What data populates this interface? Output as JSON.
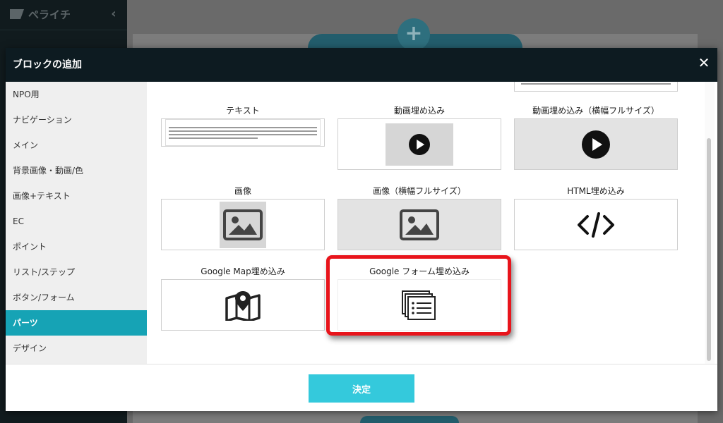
{
  "app": {
    "logo_text": "ペライチ",
    "collapse_glyph": "‹",
    "add_glyph": "+"
  },
  "modal": {
    "title": "ブロックの追加",
    "close_glyph": "✕",
    "confirm_label": "決定",
    "categories": [
      {
        "label": "NPO用",
        "active": false
      },
      {
        "label": "ナビゲーション",
        "active": false
      },
      {
        "label": "メイン",
        "active": false
      },
      {
        "label": "背景画像・動画/色",
        "active": false
      },
      {
        "label": "画像+テキスト",
        "active": false
      },
      {
        "label": "EC",
        "active": false
      },
      {
        "label": "ポイント",
        "active": false
      },
      {
        "label": "リスト/ステップ",
        "active": false
      },
      {
        "label": "ボタン/フォーム",
        "active": false
      },
      {
        "label": "パーツ",
        "active": true
      },
      {
        "label": "デザイン",
        "active": false
      }
    ],
    "tiles": [
      {
        "label": "テキスト",
        "icon": "text-lines-icon"
      },
      {
        "label": "動画埋め込み",
        "icon": "play-icon"
      },
      {
        "label": "動画埋め込み（横幅フルサイズ）",
        "icon": "play-icon"
      },
      {
        "label": "画像",
        "icon": "image-icon"
      },
      {
        "label": "画像（横幅フルサイズ）",
        "icon": "image-icon"
      },
      {
        "label": "HTML埋め込み",
        "icon": "code-icon"
      },
      {
        "label": "Google Map埋め込み",
        "icon": "map-pin-icon"
      },
      {
        "label": "Google フォーム埋め込み",
        "icon": "form-icon"
      }
    ]
  },
  "colors": {
    "accent": "#16a3b5",
    "confirm": "#34c9dc",
    "highlight": "#e8141b",
    "header": "#0d1b21"
  }
}
